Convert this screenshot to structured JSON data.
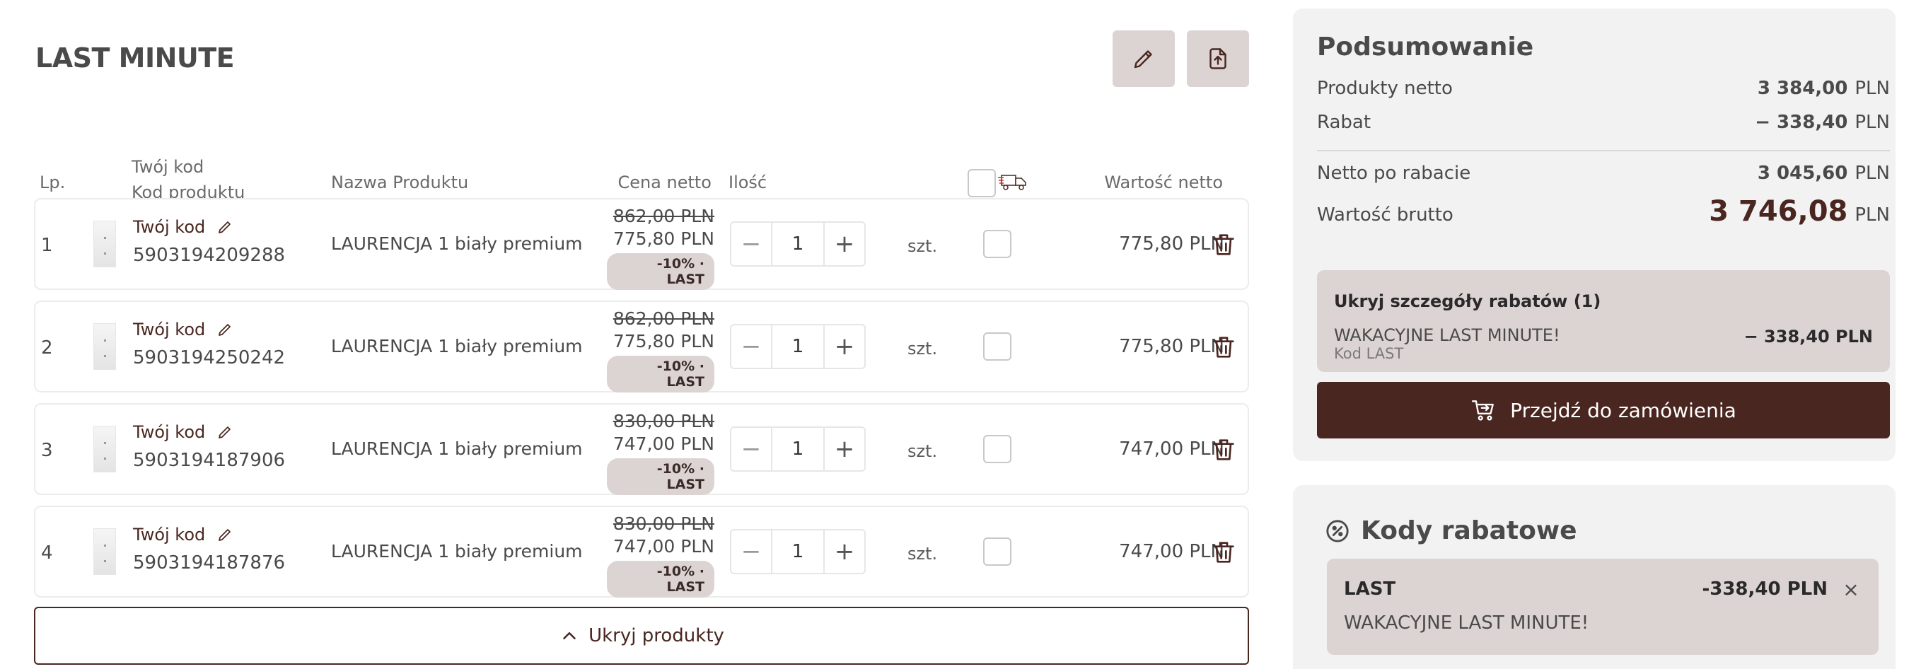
{
  "cart": {
    "title": "LAST MINUTE",
    "headers": {
      "lp": "Lp.",
      "your_code": "Twój kod",
      "product_code": "Kod produktu",
      "name": "Nazwa Produktu",
      "price": "Cena netto",
      "qty": "Ilość",
      "value": "Wartość netto"
    },
    "rows": [
      {
        "lp": "1",
        "code_label": "Twój kod",
        "ean": "5903194209288",
        "name": "LAURENCJA 1 biały premium ...",
        "old_price": "862,00 PLN",
        "new_price": "775,80 PLN",
        "badge": "-10% · LAST",
        "qty": "1",
        "unit": "szt.",
        "value": "775,80 PLN"
      },
      {
        "lp": "2",
        "code_label": "Twój kod",
        "ean": "5903194250242",
        "name": "LAURENCJA 1 biały premium ...",
        "old_price": "862,00 PLN",
        "new_price": "775,80 PLN",
        "badge": "-10% · LAST",
        "qty": "1",
        "unit": "szt.",
        "value": "775,80 PLN"
      },
      {
        "lp": "3",
        "code_label": "Twój kod",
        "ean": "5903194187906",
        "name": "LAURENCJA 1 biały premium ...",
        "old_price": "830,00 PLN",
        "new_price": "747,00 PLN",
        "badge": "-10% · LAST",
        "qty": "1",
        "unit": "szt.",
        "value": "747,00 PLN"
      },
      {
        "lp": "4",
        "code_label": "Twój kod",
        "ean": "5903194187876",
        "name": "LAURENCJA 1 biały premium ...",
        "old_price": "830,00 PLN",
        "new_price": "747,00 PLN",
        "badge": "-10% · LAST",
        "qty": "1",
        "unit": "szt.",
        "value": "747,00 PLN"
      }
    ],
    "qty_minus": "−",
    "qty_plus": "+",
    "hide_products_label": "Ukryj produkty"
  },
  "summary": {
    "title": "Podsumowanie",
    "net_label": "Produkty netto",
    "net_value": "3 384,00",
    "discount_label": "Rabat",
    "discount_value": "− 338,40",
    "after_discount_label": "Netto po rabacie",
    "after_discount_value": "3 045,60",
    "gross_label": "Wartość brutto",
    "gross_value": "3 746,08",
    "currency": "PLN",
    "discount_details": {
      "toggle_label": "Ukryj szczegóły rabatów (1)",
      "name": "WAKACYJNE LAST MINUTE!",
      "code": "Kod LAST",
      "amount": "− 338,40 PLN"
    },
    "checkout_label": "Przejdź do zamówienia"
  },
  "discount_codes": {
    "title": "Kody rabatowe",
    "items": [
      {
        "code": "LAST",
        "amount": "-338,40 PLN",
        "name": "WAKACYJNE LAST MINUTE!"
      }
    ],
    "close_glyph": "×"
  },
  "icons": {
    "edit": "pencil-icon",
    "export": "file-upload-icon",
    "delivery": "truck-icon",
    "delete": "trash-icon",
    "collapse": "chevron-up-icon",
    "checkout": "cart-arrow-icon",
    "discount": "percent-badge-icon"
  },
  "colors": {
    "brand": "#4a2620",
    "badge_bg": "#dcd4d2",
    "panel_bg": "#f2f2f2"
  }
}
